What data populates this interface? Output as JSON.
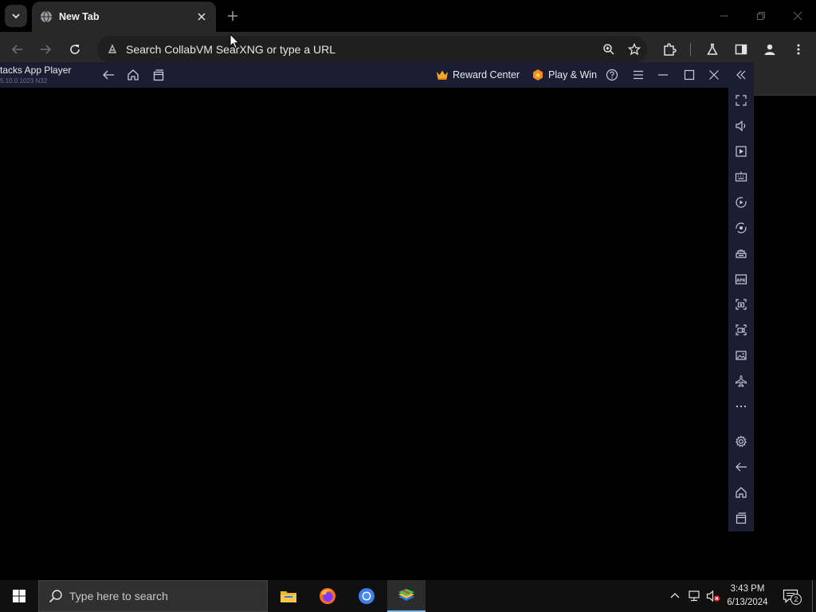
{
  "browser": {
    "tab_title": "New Tab",
    "omnibox_placeholder": "Search CollabVM SearXNG or type a URL"
  },
  "bluestacks": {
    "title": "tacks App Player",
    "version": "5.10.0.1023 N32",
    "reward_center_label": "Reward Center",
    "play_win_label": "Play & Win",
    "sidebar_items": [
      "fullscreen",
      "volume",
      "media-manager",
      "keyboard-controls",
      "macro-recorder",
      "sync",
      "game-controls",
      "install-apk",
      "screenshot",
      "screen-record",
      "gallery",
      "airplane-mode",
      "more",
      "settings",
      "back",
      "home",
      "recent-apps"
    ]
  },
  "taskbar": {
    "search_placeholder": "Type here to search",
    "time": "3:43 PM",
    "date": "6/13/2024",
    "notification_count": "2",
    "apps": [
      "file-explorer",
      "firefox",
      "chrome",
      "bluestacks"
    ]
  },
  "colors": {
    "bluestacks_chrome": "#1b1e32",
    "browser_toolbar": "#282828",
    "taskbar": "#101010",
    "accent": "#76b9ed"
  }
}
